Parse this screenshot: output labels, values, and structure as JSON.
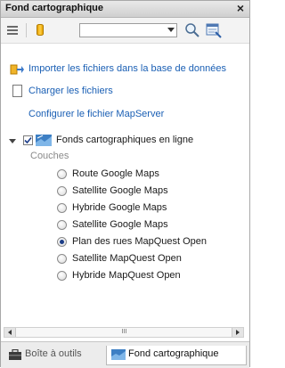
{
  "panel": {
    "title": "Fond cartographique",
    "close_glyph": "×"
  },
  "toolbar": {
    "menu_icon": "menu-icon",
    "database_icon": "database-icon",
    "combo_value": "",
    "zoom_icon": "zoom-icon",
    "properties_icon": "properties-icon"
  },
  "actions": {
    "import_label": "Importer les fichiers dans la base de données",
    "load_label": "Charger les fichiers",
    "configure_label": "Configurer le fichier MapServer"
  },
  "tree": {
    "node_label": "Fonds cartographiques en ligne",
    "node_checked": true,
    "section_label": "Couches",
    "layers": [
      {
        "label": "Route Google Maps",
        "selected": false
      },
      {
        "label": "Satellite Google Maps",
        "selected": false
      },
      {
        "label": "Hybride Google Maps",
        "selected": false
      },
      {
        "label": "Satellite Google Maps",
        "selected": false
      },
      {
        "label": "Plan des rues MapQuest Open",
        "selected": true
      },
      {
        "label": "Satellite MapQuest Open",
        "selected": false
      },
      {
        "label": "Hybride MapQuest Open",
        "selected": false
      }
    ]
  },
  "scrollbar": {
    "grip": "III"
  },
  "tabs": [
    {
      "label": "Boîte à outils",
      "active": false,
      "icon": "toolbox-icon"
    },
    {
      "label": "Fond cartographique",
      "active": true,
      "icon": "map-layers-icon"
    }
  ],
  "colors": {
    "link": "#1a5fb4",
    "section": "#8a8a8a",
    "radio_selected": "#1c3d87"
  }
}
